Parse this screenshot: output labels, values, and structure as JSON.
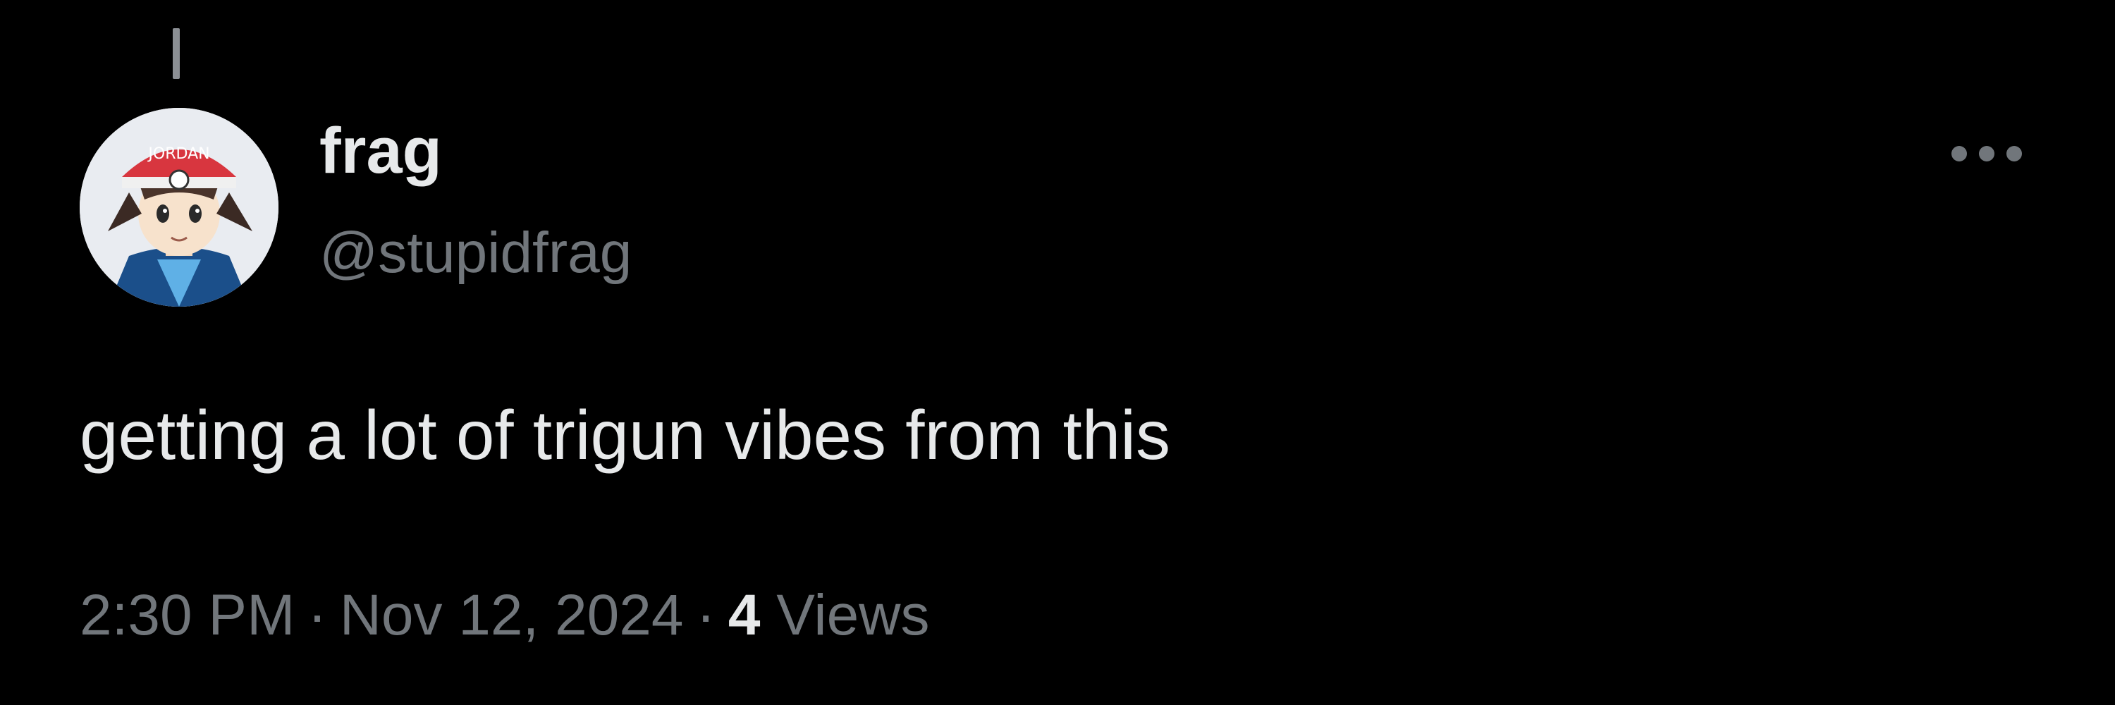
{
  "tweet": {
    "author": {
      "display_name": "frag",
      "handle": "@stupidfrag",
      "avatar_cap_text": "JORDAN"
    },
    "text": "getting a lot of trigun vibes from this",
    "meta": {
      "time": "2:30 PM",
      "separator": "·",
      "date": "Nov 12, 2024",
      "views_count": "4",
      "views_label": "Views"
    },
    "more_icon": "more-horizontal-icon"
  },
  "colors": {
    "background": "#000000",
    "primary_text": "#e7e9ea",
    "secondary_text": "#71767b"
  }
}
